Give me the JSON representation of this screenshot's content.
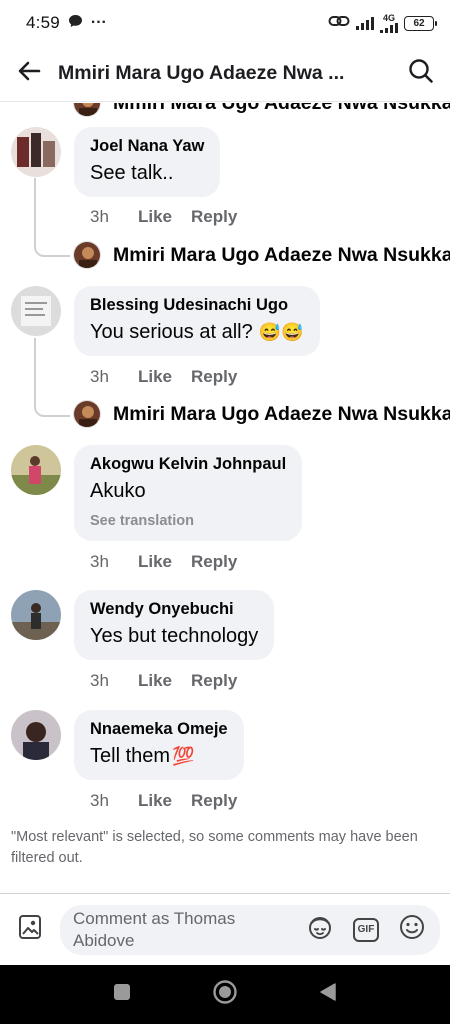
{
  "status_bar": {
    "time": "4:59",
    "dots": "···",
    "network": "4G",
    "battery": "62"
  },
  "header": {
    "title": "Mmiri Mara Ugo Adaeze Nwa ...",
    "back_icon": "arrow-left-icon",
    "search_icon": "search-icon"
  },
  "comments": [
    {
      "author": "Joel Nana Yaw",
      "text": "See talk..",
      "time": "3h",
      "like_label": "Like",
      "reply_label": "Reply",
      "reply_author": "Mmiri Mara Ugo Adaeze Nwa Nsukka"
    },
    {
      "author": "Blessing Udesinachi Ugo",
      "text": "You serious at all?",
      "emoji": "😅😅",
      "time": "3h",
      "like_label": "Like",
      "reply_label": "Reply",
      "reply_author": "Mmiri Mara Ugo Adaeze Nwa Nsukka"
    },
    {
      "author": "Akogwu Kelvin Johnpaul",
      "text": "Akuko",
      "translation_label": "See translation",
      "time": "3h",
      "like_label": "Like",
      "reply_label": "Reply"
    },
    {
      "author": "Wendy Onyebuchi",
      "text": "Yes but technology",
      "time": "3h",
      "like_label": "Like",
      "reply_label": "Reply"
    },
    {
      "author": "Nnaemeka Omeje",
      "text": "Tell them",
      "emoji": "💯",
      "time": "3h",
      "like_label": "Like",
      "reply_label": "Reply"
    }
  ],
  "top_partial_reply_author": "Mmiri Mara Ugo Adaeze Nwa Nsukka",
  "filter_note": "\"Most relevant\" is selected, so some comments may have been filtered out.",
  "composer": {
    "placeholder": "Comment as Thomas Abidove",
    "photo_icon": "image-icon",
    "avatar_icon": "avatar-sticker-icon",
    "gif_label": "GIF",
    "emoji_icon": "smiley-icon"
  },
  "nav": {
    "recents_icon": "square-icon",
    "home_icon": "circle-icon",
    "back_icon": "triangle-back-icon"
  },
  "colors": {
    "bubble": "#f0f2f5",
    "meta_text": "#65676b",
    "thread_line": "#ced0d4"
  }
}
